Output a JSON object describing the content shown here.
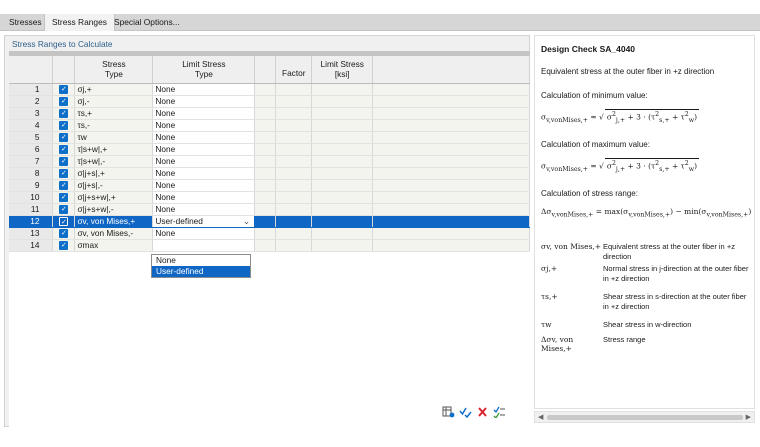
{
  "tabs": [
    {
      "label": "Stresses"
    },
    {
      "label": "Stress Ranges"
    },
    {
      "label": "Special Options..."
    }
  ],
  "left_panel": {
    "title": "Stress Ranges to Calculate",
    "columns": {
      "stress_type": "Stress\nType",
      "limit_stress_type": "Limit Stress\nType",
      "factor": "Factor",
      "limit_stress": "Limit Stress\n[ksi]"
    },
    "rows": [
      {
        "num": "1",
        "checked": true,
        "stress_type": "σj,+",
        "limit_type": "None"
      },
      {
        "num": "2",
        "checked": true,
        "stress_type": "σj,-",
        "limit_type": "None"
      },
      {
        "num": "3",
        "checked": true,
        "stress_type": "τs,+",
        "limit_type": "None"
      },
      {
        "num": "4",
        "checked": true,
        "stress_type": "τs,-",
        "limit_type": "None"
      },
      {
        "num": "5",
        "checked": true,
        "stress_type": "τw",
        "limit_type": "None"
      },
      {
        "num": "6",
        "checked": true,
        "stress_type": "τ|s+w|,+",
        "limit_type": "None"
      },
      {
        "num": "7",
        "checked": true,
        "stress_type": "τ|s+w|,-",
        "limit_type": "None"
      },
      {
        "num": "8",
        "checked": true,
        "stress_type": "σ|j+s|,+",
        "limit_type": "None"
      },
      {
        "num": "9",
        "checked": true,
        "stress_type": "σ|j+s|,-",
        "limit_type": "None"
      },
      {
        "num": "10",
        "checked": true,
        "stress_type": "σ|j+s+w|,+",
        "limit_type": "None"
      },
      {
        "num": "11",
        "checked": true,
        "stress_type": "σ|j+s+w|,-",
        "limit_type": "None"
      },
      {
        "num": "12",
        "checked": true,
        "stress_type": "σv, von Mises,+",
        "limit_type": "User-defined",
        "selected": true
      },
      {
        "num": "13",
        "checked": true,
        "stress_type": "σv, von Mises,-",
        "limit_type": "None"
      },
      {
        "num": "14",
        "checked": true,
        "stress_type": "σmax",
        "limit_type": ""
      }
    ],
    "dropdown_options": [
      "None",
      "User-defined"
    ],
    "dropdown_highlighted": "User-defined"
  },
  "right_panel": {
    "title": "Design Check SA_4040",
    "intro": "Equivalent stress at the outer fiber in +z direction",
    "min_label": "Calculation of minimum value:",
    "max_label": "Calculation of maximum value:",
    "range_label": "Calculation of stress range:",
    "legend": [
      {
        "symbol": "σv, von Mises,+",
        "desc": "Equivalent stress at the outer fiber in +z direction"
      },
      {
        "symbol": "σj,+",
        "desc": "Normal stress in j-direction at the outer fiber in +z direction"
      },
      {
        "symbol": "τs,+",
        "desc": "Shear stress in s-direction at the outer fiber in +z direction"
      },
      {
        "symbol": "τw",
        "desc": "Shear stress in w-direction"
      },
      {
        "symbol": "Δσv, von Mises,+",
        "desc": "Stress range"
      }
    ]
  },
  "toolbar_icons": [
    "table-settings-icon",
    "check-all-icon",
    "uncheck-all-icon",
    "toggle-check-icon"
  ],
  "colors": {
    "accent": "#1066c4",
    "checkbox": "#0d6fc7",
    "title_blue": "#2c5f8a",
    "uncheck_red": "#d9232d"
  }
}
